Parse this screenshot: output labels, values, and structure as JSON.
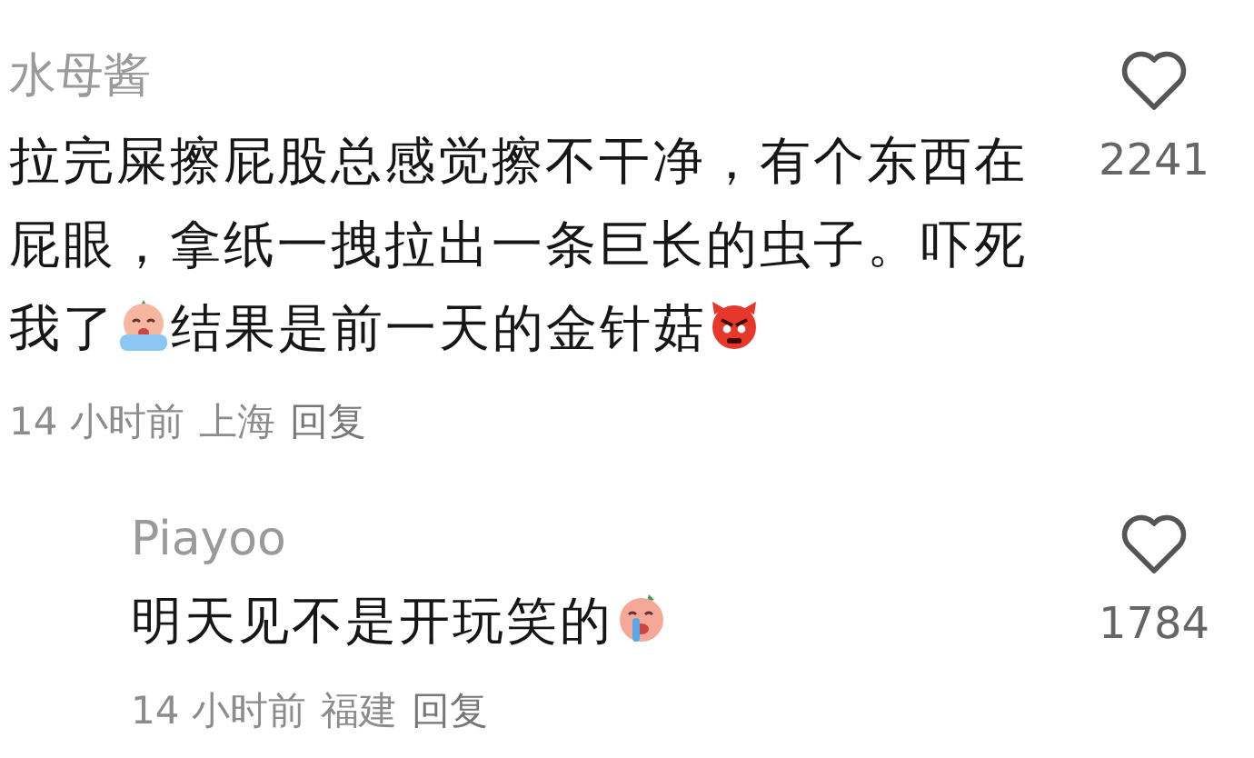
{
  "comments": [
    {
      "kind": "comment",
      "author": "水母酱",
      "body": [
        {
          "kind": "text",
          "text": "拉完屎擦屁股总感觉擦不干净，有个东西在屁眼，拿纸一拽拉出一条巨长的虫子。吓死我了"
        },
        {
          "kind": "sob"
        },
        {
          "kind": "text",
          "text": "结果是前一天的金针菇"
        },
        {
          "kind": "angry"
        }
      ],
      "time": "14 小时前",
      "location": "上海",
      "reply": "回复",
      "likes": "2241"
    },
    {
      "kind": "reply",
      "author": "Piayoo",
      "body": [
        {
          "kind": "text",
          "text": "明天见不是开玩笑的"
        },
        {
          "kind": "weep"
        }
      ],
      "time": "14 小时前",
      "location": "福建",
      "reply": "回复",
      "likes": "1784"
    }
  ]
}
